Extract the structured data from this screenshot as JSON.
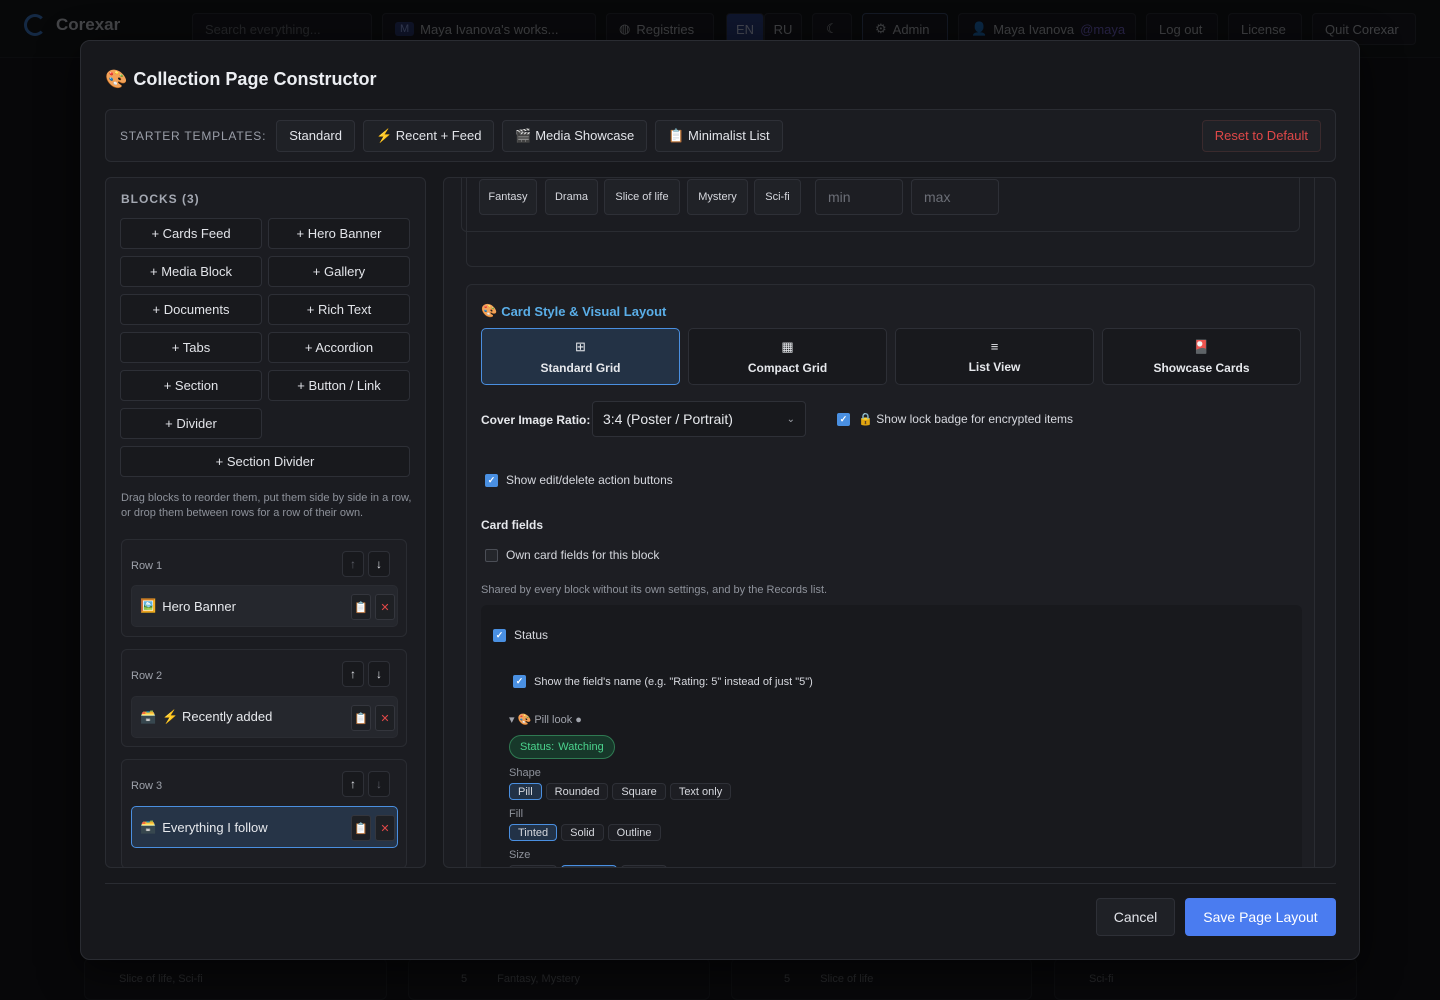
{
  "topbar": {
    "app_name": "Corexar",
    "search_placeholder": "Search everything...",
    "workspace": "Maya Ivanova's works...",
    "workspace_badge": "M",
    "registries": "Registries",
    "lang_en": "EN",
    "lang_ru": "RU",
    "admin": "Admin",
    "user_name": "Maya Ivanova",
    "user_handle": "@maya",
    "logout": "Log out",
    "license": "License",
    "quit": "Quit Corexar"
  },
  "modal": {
    "title": "Collection Page Constructor",
    "title_icon": "🎨",
    "starter_label": "STARTER TEMPLATES:",
    "templates": [
      "Standard",
      "⚡ Recent + Feed",
      "🎬 Media Showcase",
      "📋 Minimalist List"
    ],
    "reset": "Reset to Default",
    "cancel": "Cancel",
    "save": "Save Page Layout"
  },
  "blocks": {
    "heading": "BLOCKS (3)",
    "buttons": [
      "+ Cards Feed",
      "+ Hero Banner",
      "+ Media Block",
      "+ Gallery",
      "+ Documents",
      "+ Rich Text",
      "+ Tabs",
      "+ Accordion",
      "+ Section",
      "+ Button / Link",
      "+ Divider"
    ],
    "section_divider": "+ Section Divider",
    "hint": "Drag blocks to reorder them, put them side by side in a row, or drop them between rows for a row of their own.",
    "rows": [
      {
        "label": "Row 1",
        "block_icon": "🖼️",
        "block_name": "Hero Banner"
      },
      {
        "label": "Row 2",
        "block_icon": "🗃️",
        "block_name": "⚡ Recently added"
      },
      {
        "label": "Row 3",
        "block_icon": "🗃️",
        "block_name": "Everything I follow"
      }
    ]
  },
  "filters": {
    "genres": [
      "Fantasy",
      "Drama",
      "Slice of life",
      "Mystery",
      "Sci-fi"
    ],
    "min_placeholder": "min",
    "max_placeholder": "max"
  },
  "card_style": {
    "title": "Card Style & Visual Layout",
    "title_icon": "🎨",
    "layouts": [
      {
        "icon": "⊞",
        "label": "Standard Grid",
        "selected": true
      },
      {
        "icon": "▦",
        "label": "Compact Grid",
        "selected": false
      },
      {
        "icon": "≡",
        "label": "List View",
        "selected": false
      },
      {
        "icon": "🎴",
        "label": "Showcase Cards",
        "selected": false
      }
    ],
    "cover_label": "Cover Image Ratio:",
    "cover_value": "3:4 (Poster / Portrait)",
    "lock_badge": "🔒 Show lock badge for encrypted items",
    "show_actions": "Show edit/delete action buttons",
    "card_fields_heading": "Card fields",
    "own_fields": "Own card fields for this block",
    "shared_note": "Shared by every block without its own settings, and by the Records list.",
    "status_field": "Status",
    "show_field_name": "Show the field's name (e.g. \"Rating: 5\" instead of just \"5\")",
    "pill_look": "▾ 🎨 Pill look ●",
    "pill_preview_key": "Status:",
    "pill_preview_value": "Watching",
    "shape_label": "Shape",
    "shapes": [
      "Pill",
      "Rounded",
      "Square",
      "Text only"
    ],
    "fill_label": "Fill",
    "fills": [
      "Tinted",
      "Solid",
      "Outline"
    ],
    "size_label": "Size"
  },
  "background_cards": [
    "Slice of life, Sci-fi",
    "5",
    "Fantasy, Mystery",
    "5",
    "Slice of life",
    "Sci-fi"
  ],
  "colors": {
    "accent": "#4a7cf0",
    "danger": "#e04848",
    "section_title": "#5aaee8",
    "pill_green": "#4bd38d"
  }
}
